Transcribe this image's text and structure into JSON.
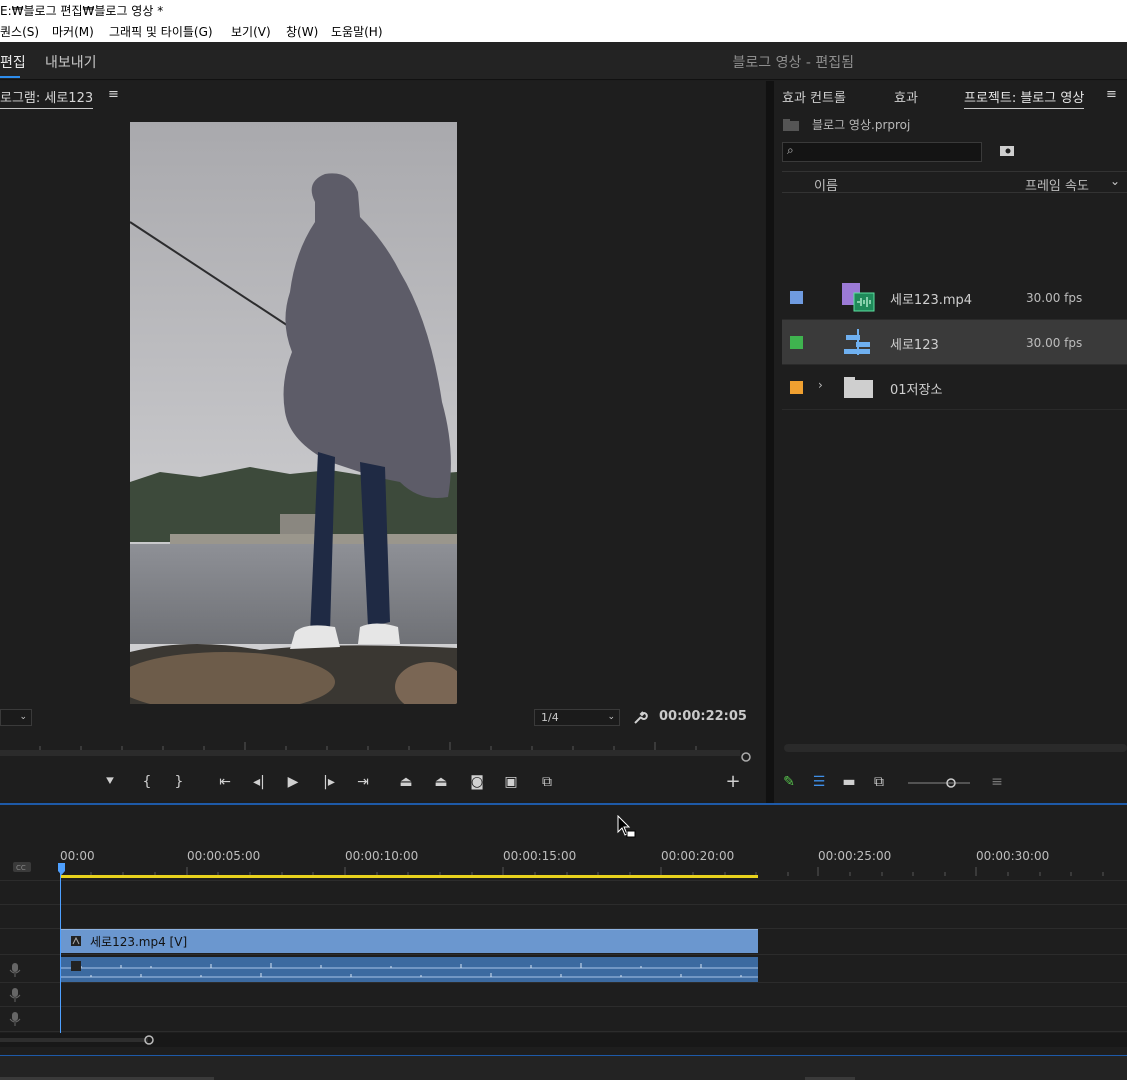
{
  "window": {
    "title": "E:₩블로그 편집₩블로그 영상 *"
  },
  "menu": [
    "퀀스(S)",
    "마커(M)",
    "그래픽 및 타이틀(G)",
    "보기(V)",
    "창(W)",
    "도움말(H)"
  ],
  "workspace": {
    "tab_edit": "편집",
    "tab_export": "내보내기",
    "doc_title": "블로그 영상 - 편집됨"
  },
  "program_monitor": {
    "title": "로그램: 세로123",
    "menu_icon": "≡",
    "resolution": "1/4",
    "timecode": "00:00:22:05"
  },
  "project_panel": {
    "tabs": [
      "효과 컨트롤",
      "효과",
      "프로젝트: 블로그 영상"
    ],
    "menu_icon": "≡",
    "file": "블로그 영상.prproj",
    "columns": {
      "name": "이름",
      "fps": "프레임 속도"
    },
    "items": [
      {
        "name": "세로123.mp4",
        "fps": "30.00 fps",
        "color": "#6f9be0",
        "icon": "video-audio-clip-icon"
      },
      {
        "name": "세로123",
        "fps": "30.00 fps",
        "color": "#3fb34f",
        "icon": "sequence-icon"
      },
      {
        "name": "01저장소",
        "fps": "",
        "color": "#f0a030",
        "icon": "folder-icon"
      }
    ]
  },
  "timeline": {
    "ruler": [
      "00:00",
      "00:00:05:00",
      "00:00:10:00",
      "00:00:15:00",
      "00:00:20:00",
      "00:00:25:00",
      "00:00:30:00"
    ],
    "video_clip": "세로123.mp4 [V]"
  },
  "colors": {
    "accent": "#2d8ceb",
    "clip_video": "#6b97cf",
    "clip_audio": "#3c6aa0",
    "work_area": "#e8d21d"
  }
}
